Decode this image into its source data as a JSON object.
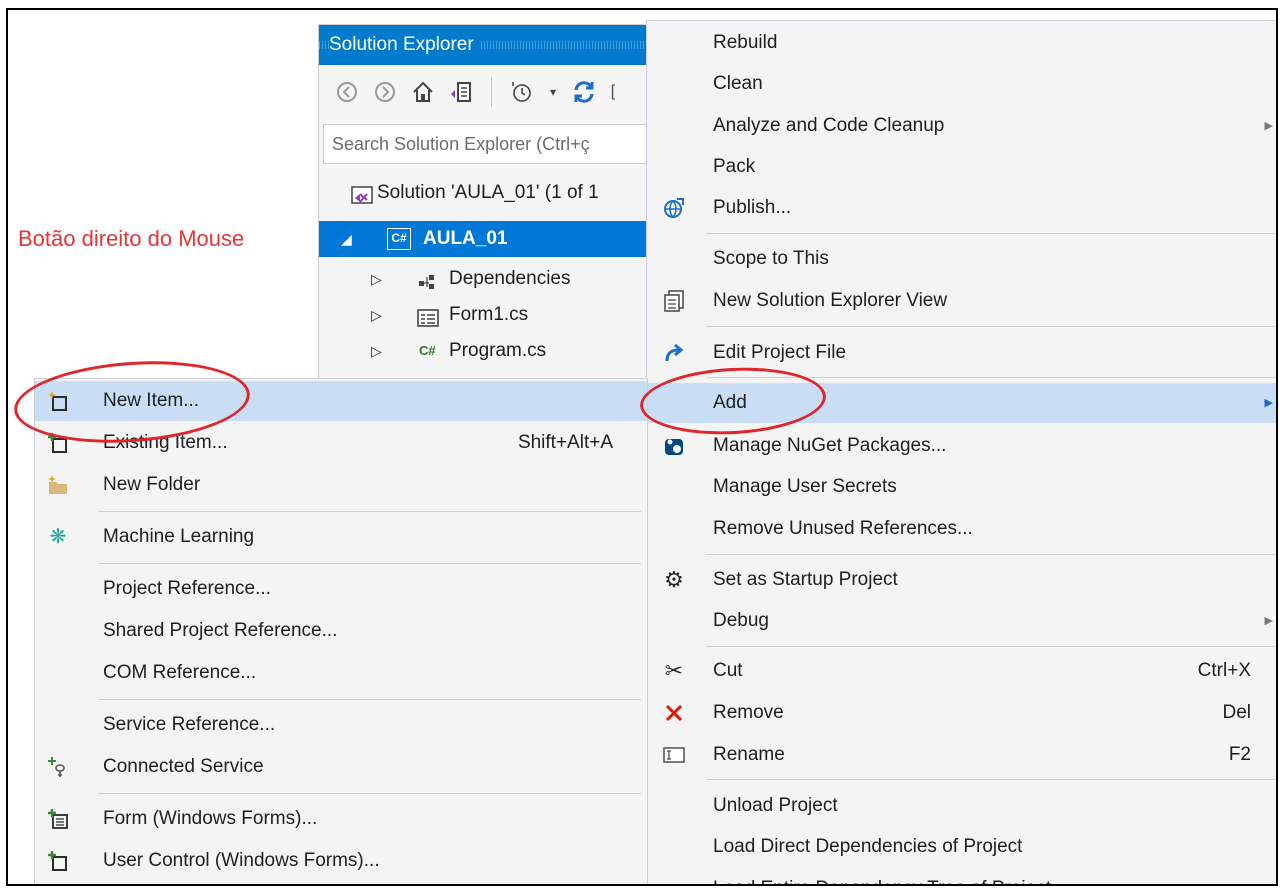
{
  "annotation": "Botão direito do Mouse",
  "solution_explorer": {
    "title": "Solution Explorer",
    "search_placeholder": "Search Solution Explorer (Ctrl+ç",
    "tree": {
      "solution": "Solution 'AULA_01' (1 of 1",
      "project": "AULA_01",
      "project_badge": "C#",
      "children": [
        "Dependencies",
        "Form1.cs",
        "Program.cs"
      ],
      "program_badge": "C#"
    }
  },
  "context_menu": {
    "items": [
      {
        "label": "Rebuild"
      },
      {
        "label": "Clean"
      },
      {
        "label": "Analyze and Code Cleanup",
        "submenu": true
      },
      {
        "label": "Pack"
      },
      {
        "label": "Publish...",
        "icon": "globe-icon"
      },
      {
        "label": "Scope to This"
      },
      {
        "label": "New Solution Explorer View",
        "icon": "window-icon"
      },
      {
        "label": "Edit Project File",
        "icon": "redirect-arrow-icon"
      },
      {
        "label": "Add",
        "submenu": true,
        "highlighted": true
      },
      {
        "label": "Manage NuGet Packages...",
        "icon": "nuget-icon"
      },
      {
        "label": "Manage User Secrets"
      },
      {
        "label": "Remove Unused References..."
      },
      {
        "label": "Set as Startup Project",
        "icon": "gear-icon"
      },
      {
        "label": "Debug",
        "submenu": true
      },
      {
        "label": "Cut",
        "shortcut": "Ctrl+X",
        "icon": "scissors-icon"
      },
      {
        "label": "Remove",
        "shortcut": "Del",
        "icon": "close-icon"
      },
      {
        "label": "Rename",
        "shortcut": "F2",
        "icon": "rename-icon"
      },
      {
        "label": "Unload Project"
      },
      {
        "label": "Load Direct Dependencies of Project"
      },
      {
        "label": "Load Entire Dependency Tree of Project"
      }
    ]
  },
  "add_submenu": {
    "items": [
      {
        "label": "New Item...",
        "highlighted": true,
        "icon": "new-item-icon"
      },
      {
        "label": "Existing Item...",
        "shortcut": "Shift+Alt+A",
        "icon": "existing-item-icon"
      },
      {
        "label": "New Folder",
        "icon": "new-folder-icon"
      },
      {
        "label": "Machine Learning",
        "icon": "machine-learning-icon"
      },
      {
        "label": "Project Reference..."
      },
      {
        "label": "Shared Project Reference..."
      },
      {
        "label": "COM Reference..."
      },
      {
        "label": "Service Reference..."
      },
      {
        "label": "Connected Service",
        "icon": "connected-service-icon"
      },
      {
        "label": "Form (Windows Forms)...",
        "icon": "form-icon"
      },
      {
        "label": "User Control (Windows Forms)...",
        "icon": "user-control-icon"
      }
    ]
  },
  "colors": {
    "accent": "#007acc",
    "selection": "#0078d7",
    "menu_highlight": "#c9def5",
    "annotation_red": "#e53535"
  }
}
